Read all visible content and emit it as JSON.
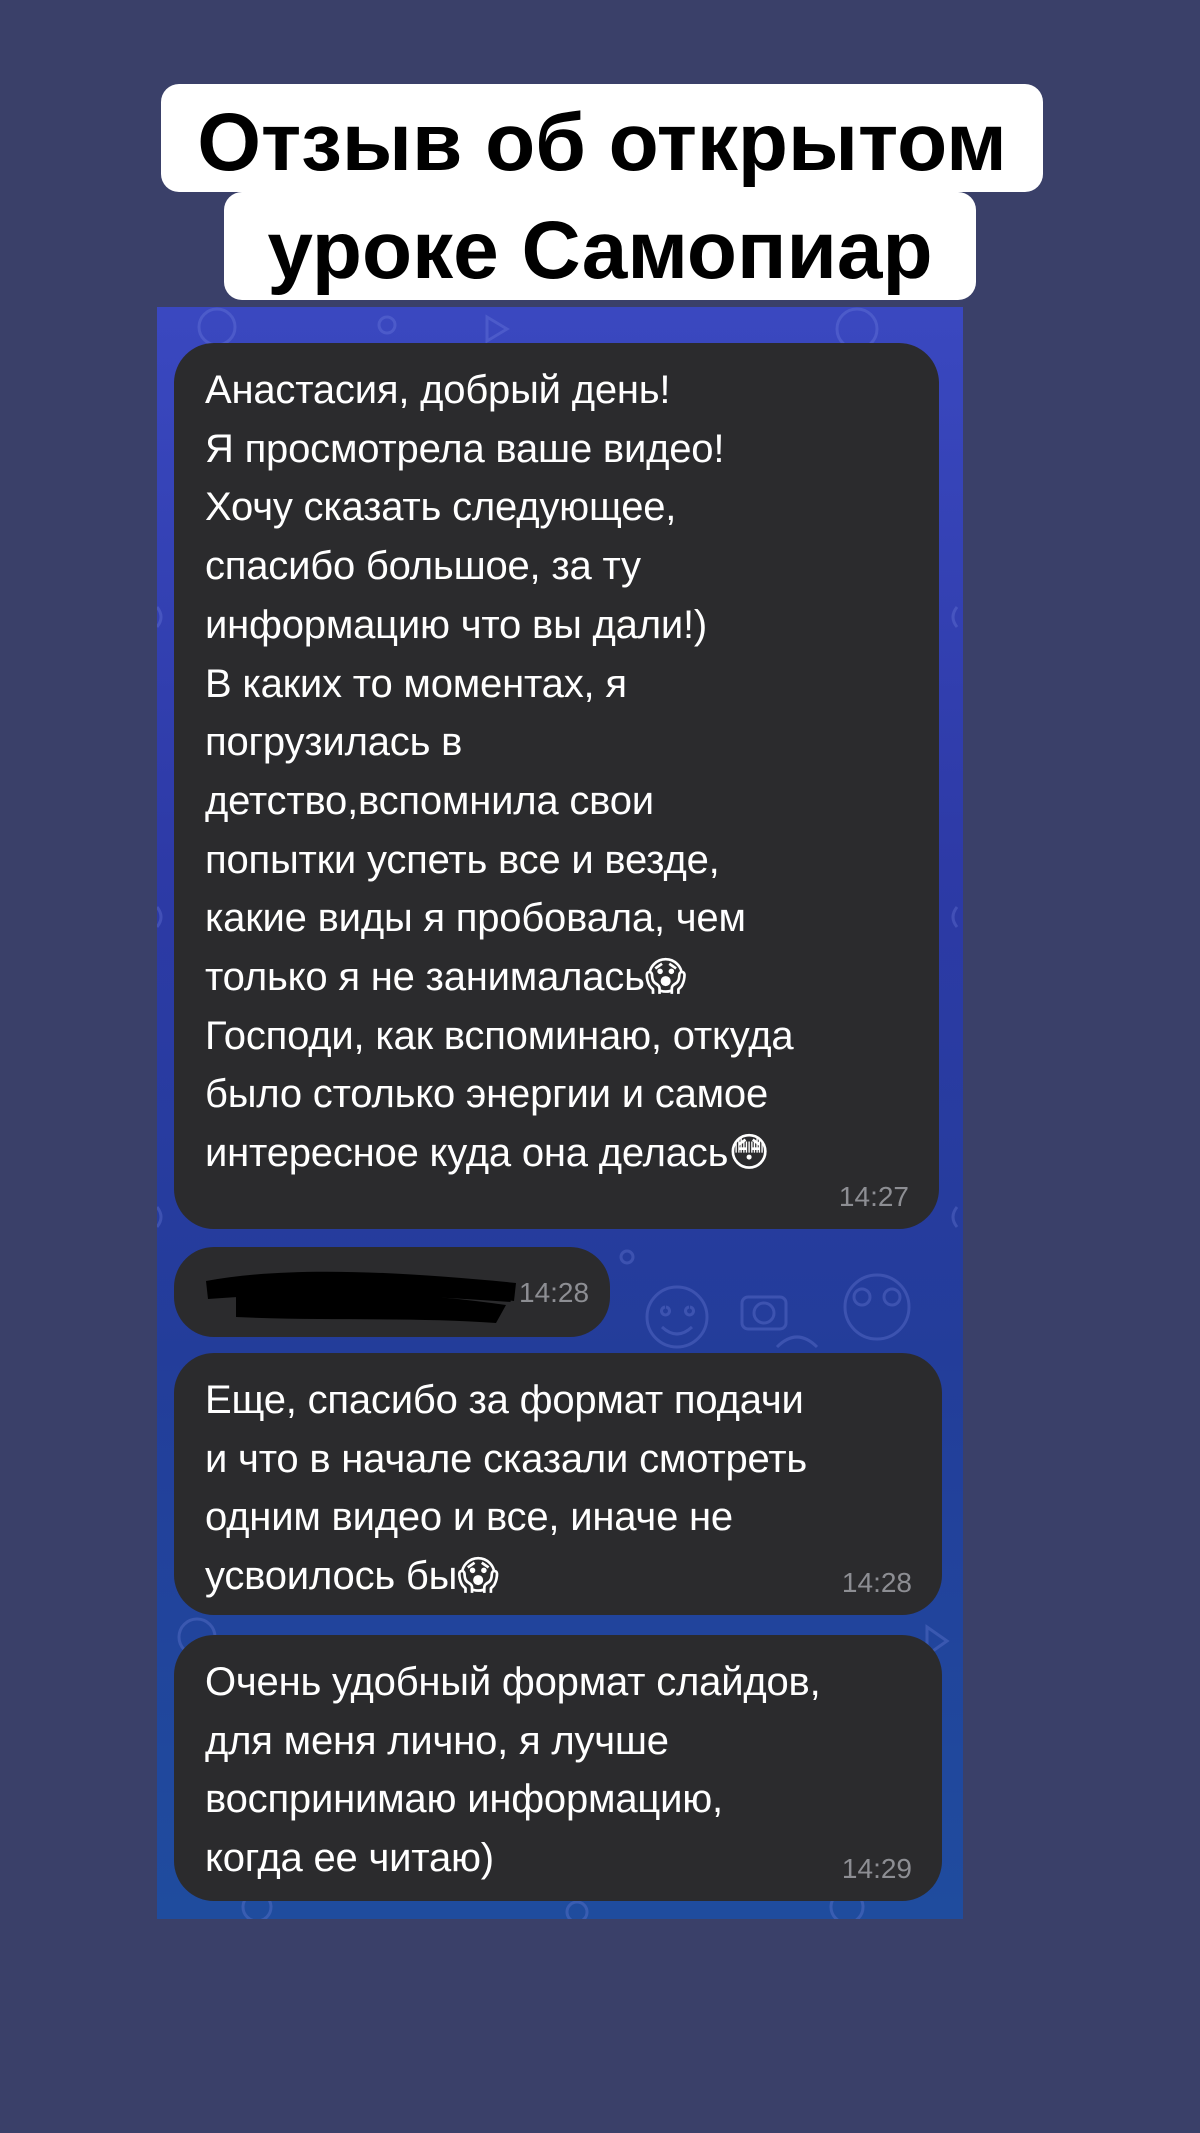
{
  "title": {
    "line1": "Отзыв об открытом",
    "line2": "уроке Самопиар"
  },
  "messages": [
    {
      "text": "Анастасия, добрый день!\nЯ просмотрела ваше видео!\nХочу сказать следующее,\nспасибо большое, за ту\nинформацию что вы дали!)\nВ каких то моментах, я\nпогрузилась в\nдетство,вспомнила свои\nпопытки успеть все и везде,\nкакие виды я пробовала, чем\nтолько я не занималась😱\nГосподи, как вспоминаю, откуда\nбыло столько энергии и самое\nинтересное куда она делась😳",
      "time": "14:27"
    },
    {
      "text": "",
      "time": "14:28",
      "redacted": true
    },
    {
      "text": "Еще, спасибо за формат подачи\nи что в начале сказали смотреть\nодним видео и все, иначе не\nусвоилось бы😱",
      "time": "14:28"
    },
    {
      "text": "Очень удобный формат слайдов,\nдля меня лично, я лучше\nвоспринимаю информацию,\nкогда ее читаю)",
      "time": "14:29"
    }
  ],
  "colors": {
    "page_background": "#3a4069",
    "bubble": "#2b2b2d",
    "timestamp": "#8d8e93",
    "chat_background": "#2d3aa6"
  }
}
